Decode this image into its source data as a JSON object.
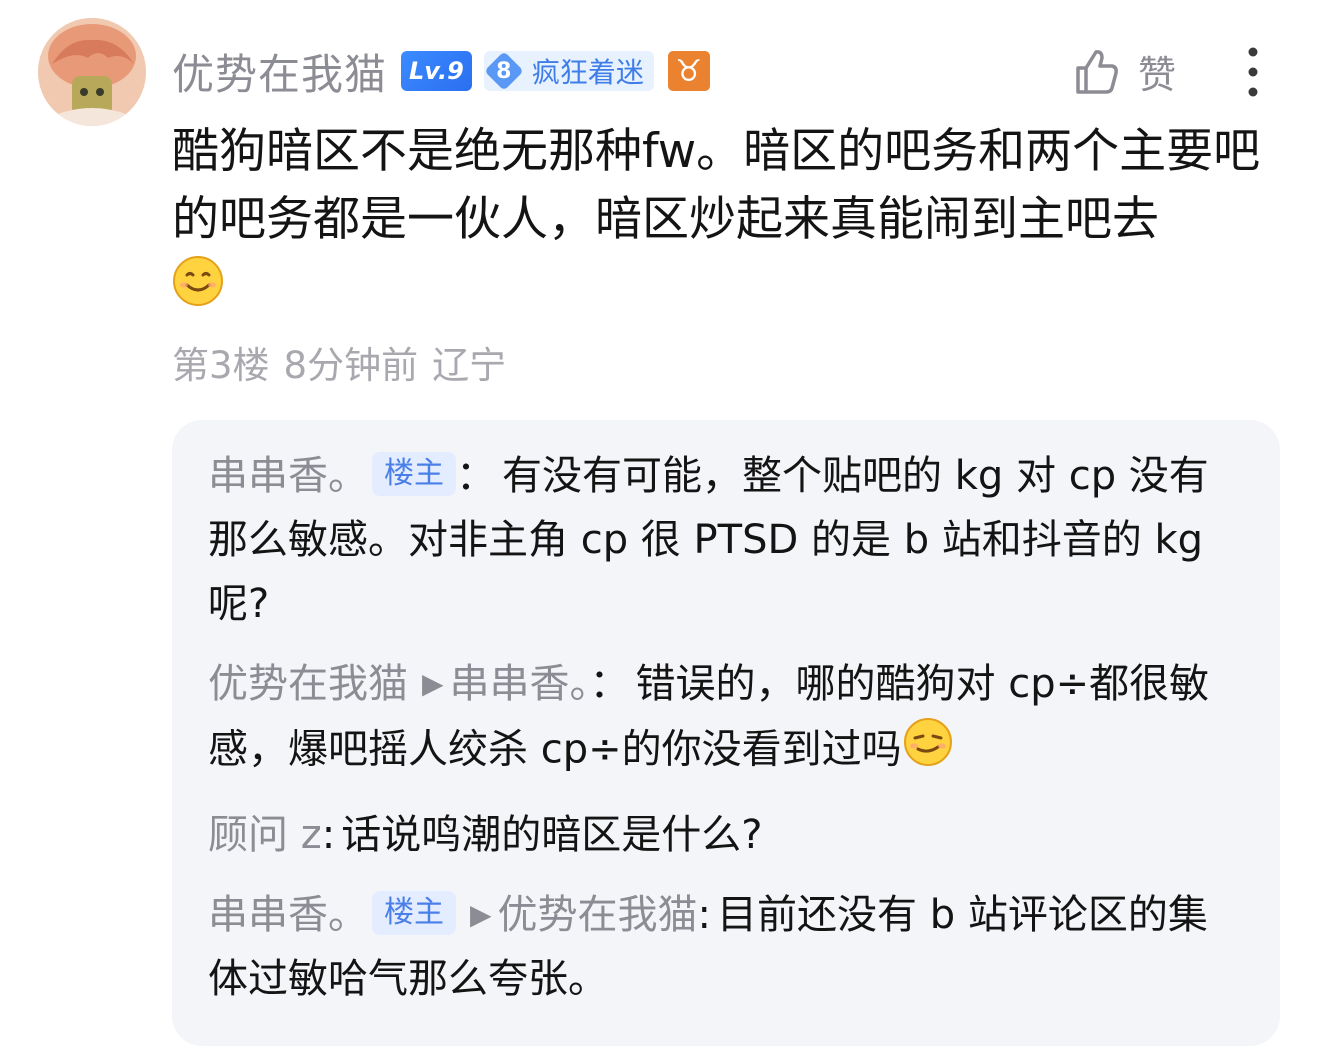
{
  "comment": {
    "username": "优势在我猫",
    "level_badge": "Lv.9",
    "fan_level": "8",
    "fan_title": "疯狂着迷",
    "zodiac_symbol": "♉",
    "like_label": "赞",
    "text": "酷狗暗区不是绝无那种fw。暗区的吧务和两个主要吧的吧务都是一伙人，暗区炒起来真能闹到主吧去",
    "emoji": "smile-emoji",
    "floor": "第3楼",
    "time": "8分钟前",
    "location": "辽宁"
  },
  "replies": [
    {
      "name": "串串香。",
      "badge": "楼主",
      "target": "",
      "colon": "：",
      "text": "有没有可能，整个贴吧的 kg 对 cp 没有那么敏感。对非主角 cp 很 PTSD 的是 b 站和抖音的 kg 呢?"
    },
    {
      "name": "优势在我猫",
      "badge": "",
      "target": "串串香。",
      "colon": "：",
      "text": "错误的，哪的酷狗对 cp÷都很敏感，爆吧摇人绞杀 cp÷的你没看到过吗",
      "emoji": "smug-emoji"
    },
    {
      "name": "顾问 z",
      "badge": "",
      "target": "",
      "colon": ":",
      "text": "话说鸣潮的暗区是什么?"
    },
    {
      "name": "串串香。",
      "badge": "楼主",
      "target": "优势在我猫",
      "colon": ":",
      "text": "目前还没有 b 站评论区的集体过敏哈气那么夸张。"
    }
  ],
  "colors": {
    "name_gray": "#8c8c94",
    "meta_gray": "#a8a8ae",
    "level_blue": "#2a6ff0",
    "fan_blue": "#3f7ee8",
    "zodiac_orange": "#ea8230",
    "reply_bg": "#f4f5f8",
    "op_badge_bg": "#e4ecff"
  }
}
